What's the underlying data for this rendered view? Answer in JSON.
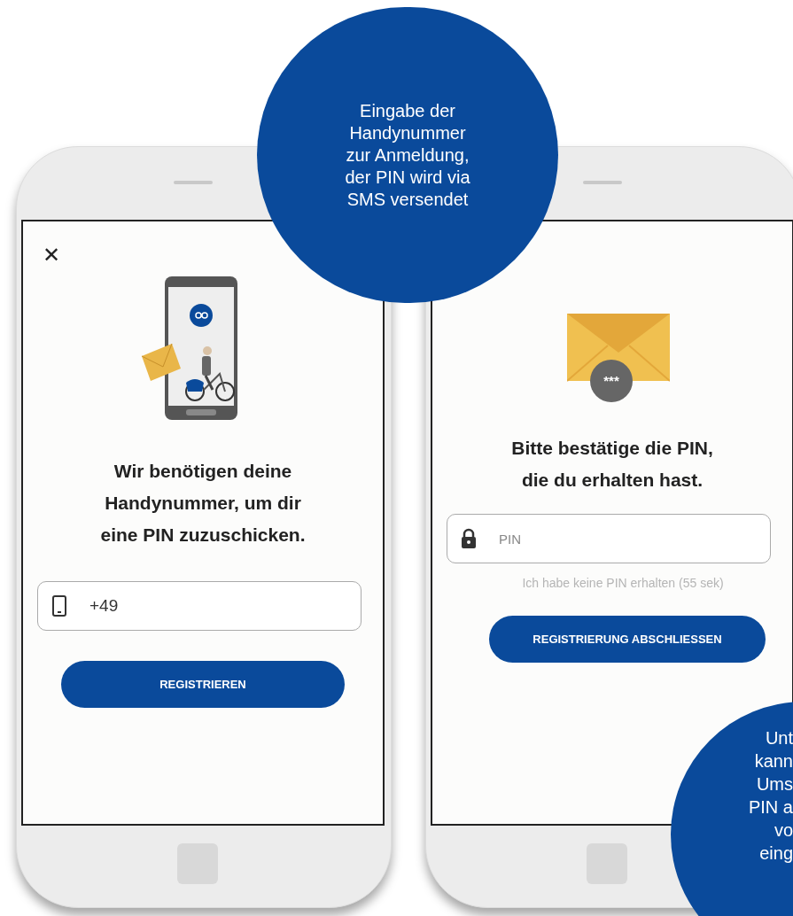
{
  "callouts": [
    {
      "kind": "top",
      "lines": [
        "Eingabe der",
        "Handynummer",
        "zur Anmeldung,",
        "der PIN wird via",
        "SMS versendet"
      ]
    },
    {
      "kind": "corner",
      "lines": [
        "Unt",
        "kann",
        "Ums",
        "PIN a",
        "vo",
        "eing"
      ]
    }
  ],
  "screens": [
    {
      "kind": "phone_number",
      "close": "✕",
      "heading": "Wir benötigen deine Handynummer, um dir eine PIN zuzuschicken.",
      "field": {
        "value": "+49"
      },
      "button": "REGISTRIEREN"
    },
    {
      "kind": "pin",
      "badge": "***",
      "heading": "Bitte bestätige die PIN, die du erhalten hast.",
      "field": {
        "placeholder": "PIN"
      },
      "hint": "Ich habe keine PIN erhalten (55 sek)",
      "button": "REGISTRIERUNG ABSCHLIESSEN"
    }
  ]
}
